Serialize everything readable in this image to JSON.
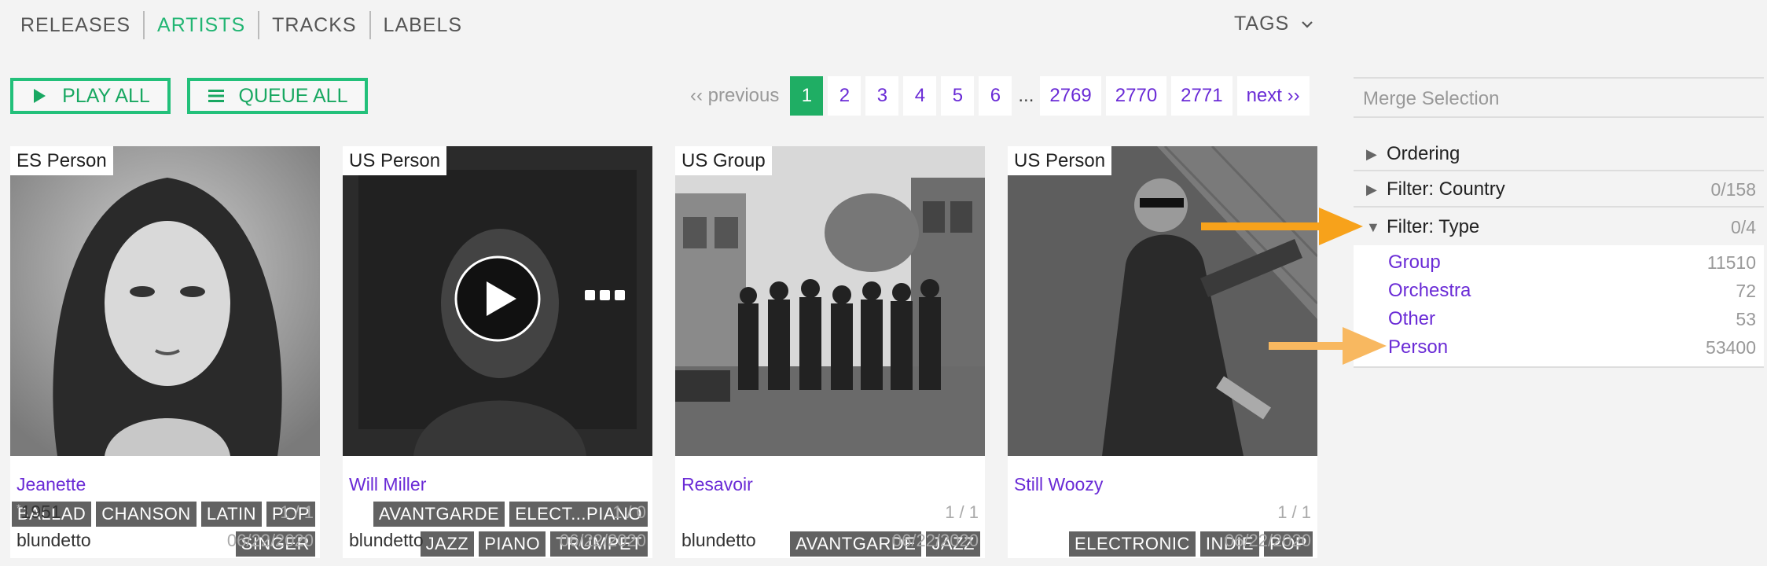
{
  "nav": {
    "items": [
      {
        "label": "RELEASES",
        "active": false
      },
      {
        "label": "ARTISTS",
        "active": true
      },
      {
        "label": "TRACKS",
        "active": false
      },
      {
        "label": "LABELS",
        "active": false
      }
    ],
    "tags_label": "TAGS"
  },
  "actions": {
    "play_all": "PLAY ALL",
    "queue_all": "QUEUE ALL"
  },
  "pagination": {
    "previous": "‹‹ previous",
    "pages": [
      "1",
      "2",
      "3",
      "4",
      "5",
      "6"
    ],
    "ellipsis": "...",
    "last_pages": [
      "2769",
      "2770",
      "2771"
    ],
    "current": "1",
    "next": "next ››"
  },
  "cards": [
    {
      "location": "ES Person",
      "name": "Jeanette",
      "tag_rows": [
        [
          "BALLAD",
          "CHANSON",
          "LATIN",
          "POP"
        ],
        [
          "SINGER"
        ]
      ],
      "ratio": "1 / 1",
      "born": "1951",
      "user": "blundetto",
      "date": "06/22/2020"
    },
    {
      "location": "US Person",
      "name": "Will Miller",
      "tag_rows": [
        [
          "AVANTGARDE",
          "ELECT...PIANO"
        ],
        [
          "JAZZ",
          "PIANO",
          "TRUMPET"
        ]
      ],
      "ratio": "1 / 0",
      "born": "",
      "user": "blundetto",
      "date": "06/22/2020"
    },
    {
      "location": "US Group",
      "name": "Resavoir",
      "tag_rows": [
        [
          "AVANTGARDE",
          "JAZZ"
        ]
      ],
      "ratio": "1 / 1",
      "born": "",
      "user": "blundetto",
      "date": "06/22/2020"
    },
    {
      "location": "US Person",
      "name": "Still Woozy",
      "tag_rows": [
        [
          "ELECTRONIC",
          "INDIE",
          "POP"
        ]
      ],
      "ratio": "1 / 1",
      "born": "",
      "user": "",
      "date": "06/22/2020"
    }
  ],
  "sidebar": {
    "merge_placeholder": "Merge Selection",
    "ordering": "Ordering",
    "filter_country": {
      "label": "Filter: Country",
      "count": "0/158"
    },
    "filter_type": {
      "label": "Filter: Type",
      "count": "0/4"
    },
    "type_options": [
      {
        "label": "Group",
        "count": "11510"
      },
      {
        "label": "Orchestra",
        "count": "72"
      },
      {
        "label": "Other",
        "count": "53"
      },
      {
        "label": "Person",
        "count": "53400"
      }
    ]
  },
  "colors": {
    "accent_green": "#22c07a",
    "link_purple": "#6a2bd6",
    "arrow_orange": "#f7a21b",
    "arrow_orange_light": "#f8b860"
  }
}
